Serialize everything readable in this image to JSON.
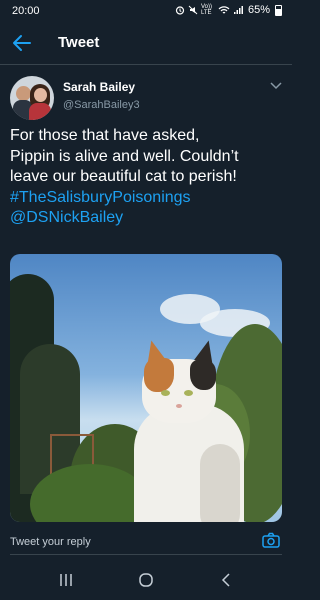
{
  "status_bar": {
    "time": "20:00",
    "network_label": "Vo)) LTE",
    "battery": "65%"
  },
  "header": {
    "title": "Tweet"
  },
  "author": {
    "name": "Sarah Bailey",
    "handle": "@SarahBailey3"
  },
  "tweet": {
    "text_lines": [
      "For those that have asked,",
      "Pippin is alive and well. Couldn’t",
      "leave our beautiful cat to perish!"
    ],
    "hashtag": "#TheSalisburyPoisonings",
    "mention": "@DSNickBailey"
  },
  "reply": {
    "placeholder": "Tweet your reply"
  },
  "colors": {
    "background": "#15202b",
    "accent": "#1da1f2",
    "muted": "#8899a6",
    "divider": "#38444d"
  },
  "icons": [
    "back-arrow-icon",
    "chevron-down-icon",
    "camera-icon",
    "recent-apps-icon",
    "home-icon",
    "back-nav-icon",
    "alarm-icon",
    "mute-icon",
    "wifi-icon",
    "signal-icon",
    "battery-icon"
  ]
}
